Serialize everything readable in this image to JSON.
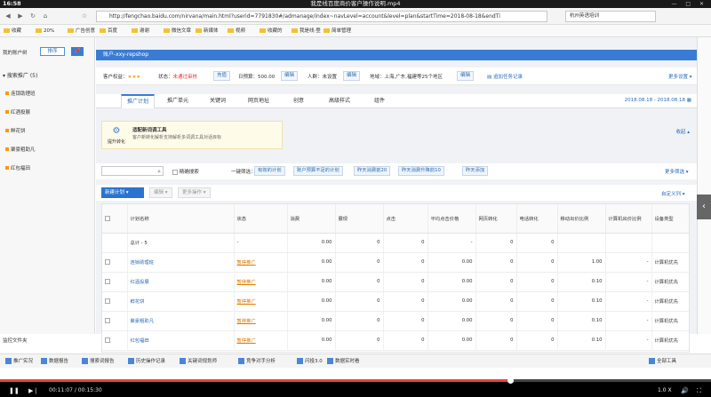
{
  "video": {
    "clock": "16:58",
    "title": "我是线百度商价客户操作说明.mp4",
    "window_controls": "— □ ✕",
    "elapsed": "00:11:07",
    "total": "00:15:30",
    "speed": "1.0 X",
    "progress": 0.717
  },
  "browser": {
    "back_icon": "◀",
    "forward_icon": "▶",
    "refresh_icon": "↻",
    "home_icon": "⌂",
    "star_icon": "☆",
    "url": "http://fengchao.baidu.com/nirvana/main.html?userid=7791830#/admanage/index~navLevel=account&level=plan&startTime=2018-08-18&endTi",
    "search_text": "杭州英语培训",
    "bookmarks": [
      "收藏",
      "20%",
      "广告创意",
      "百度",
      "谢谢",
      "微信文章",
      "新媒体",
      "视频",
      "收藏的",
      "我是线·登",
      "简单管理"
    ]
  },
  "sidebar": {
    "heading": "我的账户树",
    "sort_label": "排序",
    "pin_label": "📌",
    "plan_group": "搜索推广 (5)",
    "plans": [
      "连锁助理班",
      "红酒投展",
      "鲜花饼",
      "聚豪粗助凡",
      "红包福田"
    ],
    "footer": "监控文件夹"
  },
  "header": {
    "account": "账户-xxy-repshop"
  },
  "info": {
    "star_label": "客户权益：",
    "stars": "★★★",
    "status_label": "状态：",
    "status_value": "未通过审核",
    "status_btn": "充值",
    "budget_label": "日预算：",
    "budget_value": "500.00",
    "budget_btn": "编辑",
    "people_label": "人群：",
    "people_value": "未设置",
    "people_btn": "编辑",
    "region_label": "地域：",
    "region_value": "上海,广东,福建等25个地区",
    "region_btn": "编辑",
    "task_link": "追加任务记录",
    "more_link": "更多设置 ▾"
  },
  "tabs": [
    "推广计划",
    "推广单元",
    "关键词",
    "网页地址",
    "创意",
    "高级样式",
    "组件"
  ],
  "daterange": "2018.08.18 - 2018.08.18 ▦",
  "tip": {
    "icon_label": "提升转化",
    "title": "适配新词调工具",
    "desc": "客户新转化解析支持解析多词调工具对话目标"
  },
  "collapse": "收起 ▴",
  "filter": {
    "precise_label": "精确搜索",
    "quick_label": "一键筛选：",
    "buttons": [
      "有效的计划",
      "账户预算不足的计划",
      "昨天消费前20",
      "昨天消费升降前10",
      "昨天添加"
    ],
    "more_filter": "更多筛选 ▾"
  },
  "actions": {
    "new_plan": "新建计划",
    "new_caret": "▾",
    "edit": "编辑 ▾",
    "more_ops": "更多操作 ▾",
    "custom_cols": "自定义列 ▾"
  },
  "table": {
    "headers": [
      "计划名称",
      "状态",
      "消费",
      "展现",
      "点击",
      "平均点击价格",
      "网页转化",
      "电话转化",
      "移动出价比例",
      "计算机出价比例",
      "设备类型"
    ],
    "total_row": [
      "总计 - 5",
      "-",
      "0.00",
      "0",
      "0",
      "-",
      "0",
      "0",
      "",
      "",
      ""
    ],
    "rows": [
      [
        "连锁助理班",
        "暂停推广",
        "0.00",
        "0",
        "0",
        "0.00",
        "0",
        "0",
        "1.00",
        "-",
        "计算机优先"
      ],
      [
        "红酒投展",
        "暂停推广",
        "0.00",
        "0",
        "0",
        "0.00",
        "0",
        "0",
        "0.10",
        "-",
        "计算机优先"
      ],
      [
        "鲜花饼",
        "暂停推广",
        "0.00",
        "0",
        "0",
        "0.00",
        "0",
        "0",
        "0.10",
        "-",
        "计算机优先"
      ],
      [
        "聚豪粗助凡",
        "暂停推广",
        "0.00",
        "0",
        "0",
        "0.00",
        "0",
        "0",
        "0.10",
        "-",
        "计算机优先"
      ],
      [
        "红包福田",
        "暂停推广",
        "0.00",
        "0",
        "0",
        "0.00",
        "0",
        "0",
        "0.10",
        "-",
        "计算机优先"
      ]
    ]
  },
  "toolbar": [
    "推广实况",
    "数据报告",
    "搜索词报告",
    "历史操作记录",
    "关键词规划师",
    "竞争对手分析",
    "闪投3.0",
    "数据实时看"
  ],
  "toolbar_right": "全部工具",
  "edge_icon": "‹",
  "colors": {
    "accent": "#3a7cd5",
    "alert": "#e33333",
    "link": "#2b6cb3",
    "progress": "#e8433a"
  }
}
